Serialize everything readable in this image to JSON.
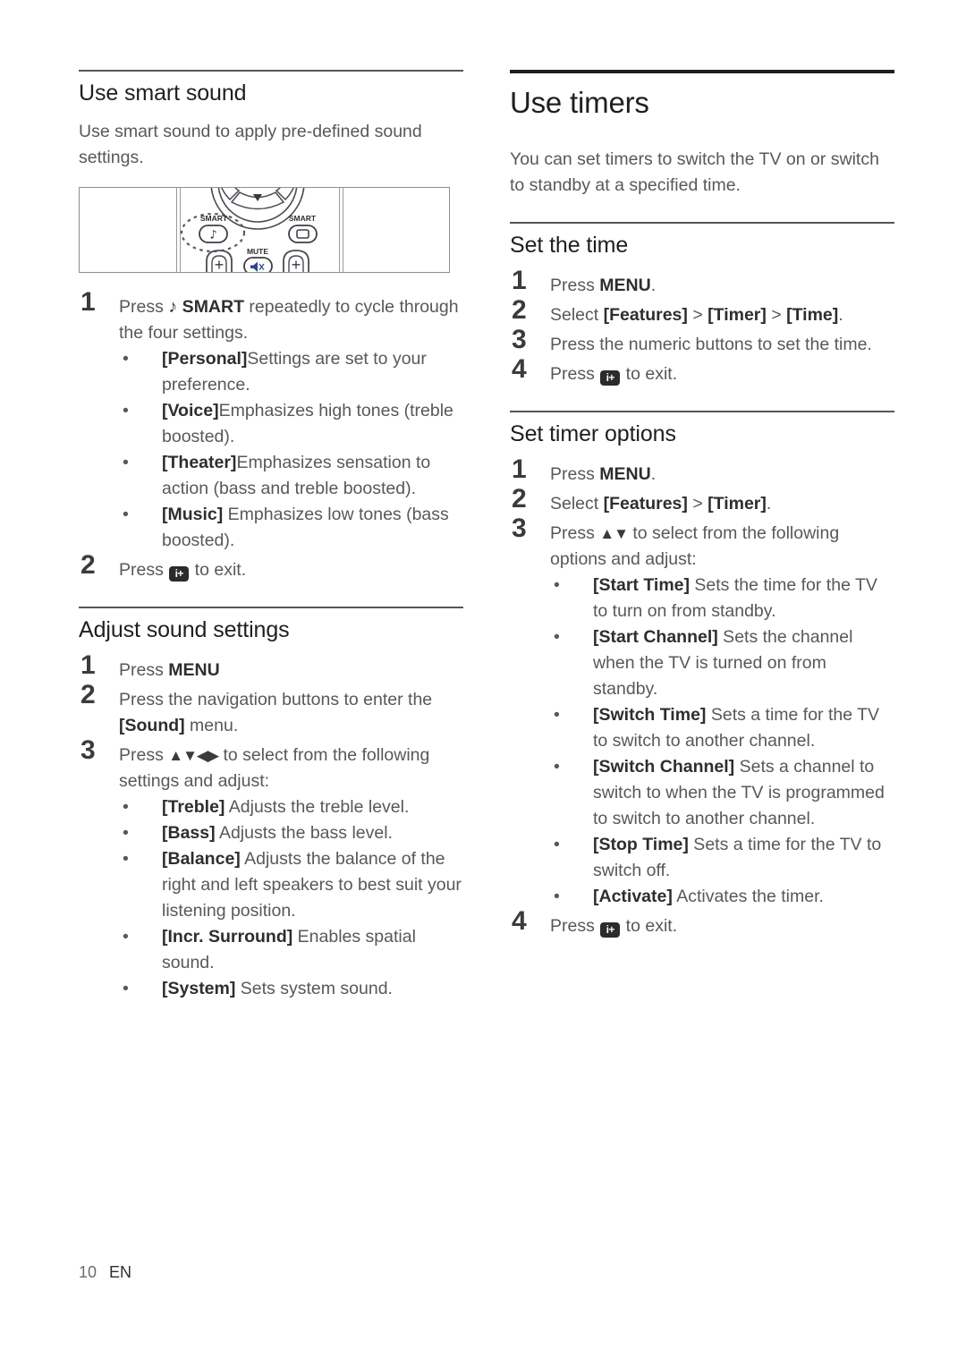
{
  "footer": {
    "page_number": "10",
    "language": "EN"
  },
  "left_column": {
    "section1": {
      "heading": "Use smart sound",
      "intro": "Use smart sound to apply pre-defined sound settings.",
      "figure": {
        "name": "remote-control-smart-buttons",
        "labels": {
          "smart_left": "SMART",
          "smart_right": "SMART",
          "mute": "MUTE",
          "plus_left": "+",
          "plus_right": "+",
          "note_symbol": "♪",
          "down_arrow": "▼"
        }
      },
      "steps": [
        {
          "num": "1",
          "pre": "Press ",
          "glyph": "♪",
          "bold": " SMART",
          "post": " repeatedly to cycle through the four settings.",
          "bullets": [
            {
              "term": "[Personal]",
              "desc": "Settings are set to your preference."
            },
            {
              "term": "[Voice]",
              "desc": "Emphasizes high tones (treble boosted)."
            },
            {
              "term": "[Theater]",
              "desc": "Emphasizes sensation to action (bass and treble boosted)."
            },
            {
              "term": "[Music]",
              "desc": " Emphasizes low tones (bass boosted)."
            }
          ]
        },
        {
          "num": "2",
          "pre": "Press ",
          "icon": "i+",
          "post": " to exit."
        }
      ]
    },
    "section2": {
      "heading": "Adjust sound settings",
      "steps": [
        {
          "num": "1",
          "pre": "Press ",
          "bold": "MENU",
          "post": ""
        },
        {
          "num": "2",
          "pre": "Press the navigation buttons to enter the ",
          "bold": "[Sound]",
          "post": " menu."
        },
        {
          "num": "3",
          "pre": "Press ",
          "arrows": "▲▼◀▶",
          "post": " to select from the following settings and adjust:",
          "bullets": [
            {
              "term": "[Treble]",
              "desc": " Adjusts the treble level."
            },
            {
              "term": "[Bass]",
              "desc": " Adjusts the bass level."
            },
            {
              "term": "[Balance]",
              "desc": " Adjusts the balance of the right and left speakers to best suit your listening position."
            },
            {
              "term": "[Incr. Surround]",
              "desc": " Enables spatial sound."
            },
            {
              "term": "[System]",
              "desc": " Sets system sound."
            }
          ]
        }
      ]
    }
  },
  "right_column": {
    "chapter_heading": "Use timers",
    "intro": "You can set timers to switch the TV on or switch to standby at a specified time.",
    "section1": {
      "heading": "Set the time",
      "steps": [
        {
          "num": "1",
          "pre": "Press ",
          "bold": "MENU",
          "post": "."
        },
        {
          "num": "2",
          "pre": "Select ",
          "bold": "[Features]",
          "mid1": " > ",
          "bold2": "[Timer]",
          "mid2": " > ",
          "bold3": "[Time]",
          "post": "."
        },
        {
          "num": "3",
          "pre": "Press the numeric buttons to set the time.",
          "post": ""
        },
        {
          "num": "4",
          "pre": "Press ",
          "icon": "i+",
          "post": " to exit."
        }
      ]
    },
    "section2": {
      "heading": "Set timer options",
      "steps": [
        {
          "num": "1",
          "pre": "Press ",
          "bold": "MENU",
          "post": "."
        },
        {
          "num": "2",
          "pre": "Select ",
          "bold": "[Features]",
          "mid1": " > ",
          "bold2": "[Timer]",
          "post": "."
        },
        {
          "num": "3",
          "pre": "Press ",
          "arrows": "▲▼",
          "post": " to select from the following options and adjust:",
          "bullets": [
            {
              "term": "[Start Time]",
              "desc": " Sets the time for the TV to turn on from standby."
            },
            {
              "term": "[Start Channel]",
              "desc": " Sets the channel when the TV is turned on from standby."
            },
            {
              "term": "[Switch Time]",
              "desc": " Sets a time for the TV to switch to another channel."
            },
            {
              "term": "[Switch Channel]",
              "desc": " Sets a channel to switch to when the TV is programmed to switch to another channel."
            },
            {
              "term": "[Stop Time]",
              "desc": " Sets a time for the TV to switch off."
            },
            {
              "term": "[Activate]",
              "desc": " Activates the timer."
            }
          ]
        },
        {
          "num": "4",
          "pre": "Press ",
          "icon": "i+",
          "post": " to exit."
        }
      ]
    }
  }
}
